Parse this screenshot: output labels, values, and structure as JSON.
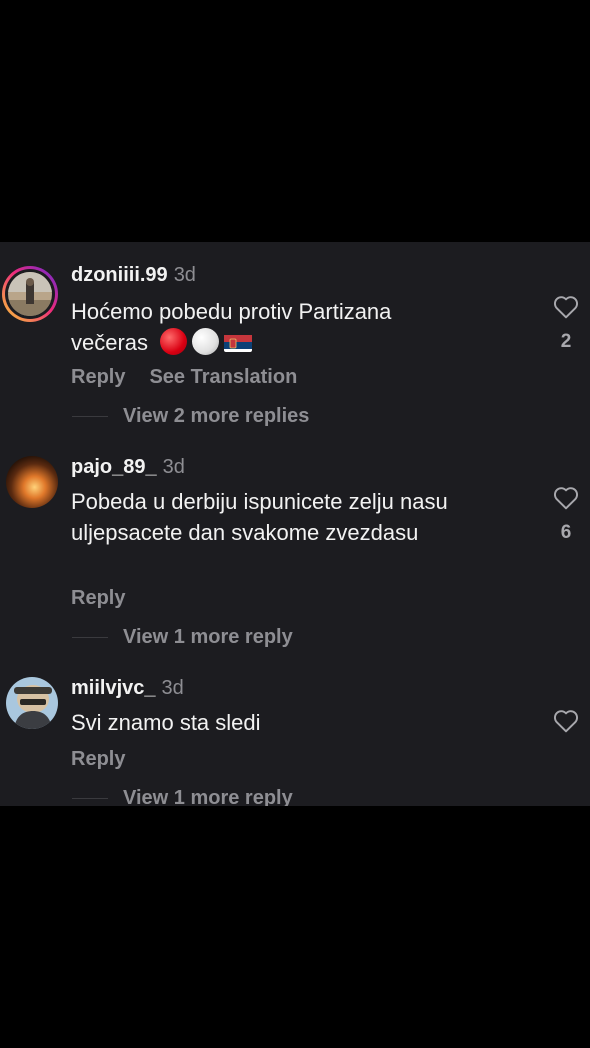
{
  "comments": [
    {
      "username": "dzoniiii.99",
      "time": "3d",
      "text_line1": "Hoćemo pobedu protiv Partizana",
      "text_line2": "večeras",
      "emojis": [
        "red-circle",
        "white-circle",
        "serbia-flag"
      ],
      "reply_label": "Reply",
      "translate_label": "See Translation",
      "likes": "2",
      "view_replies": "View 2 more replies",
      "avatar_has_story": true
    },
    {
      "username": "pajo_89_",
      "time": "3d",
      "text": "Pobeda u derbiju ispunicete zelju nasu uljepsacete dan svakome zvezdasu",
      "reply_label": "Reply",
      "likes": "6",
      "view_replies": "View 1 more reply"
    },
    {
      "username": "miilvjvc_",
      "time": "3d",
      "text": "Svi znamo sta sledi",
      "reply_label": "Reply",
      "view_replies": "View 1 more reply"
    }
  ],
  "colors": {
    "background": "#000000",
    "panel": "#1c1c20",
    "primary_text": "#f2f2f2",
    "secondary_text": "#8e8e93"
  },
  "icons": {
    "like": "heart-outline-icon"
  }
}
